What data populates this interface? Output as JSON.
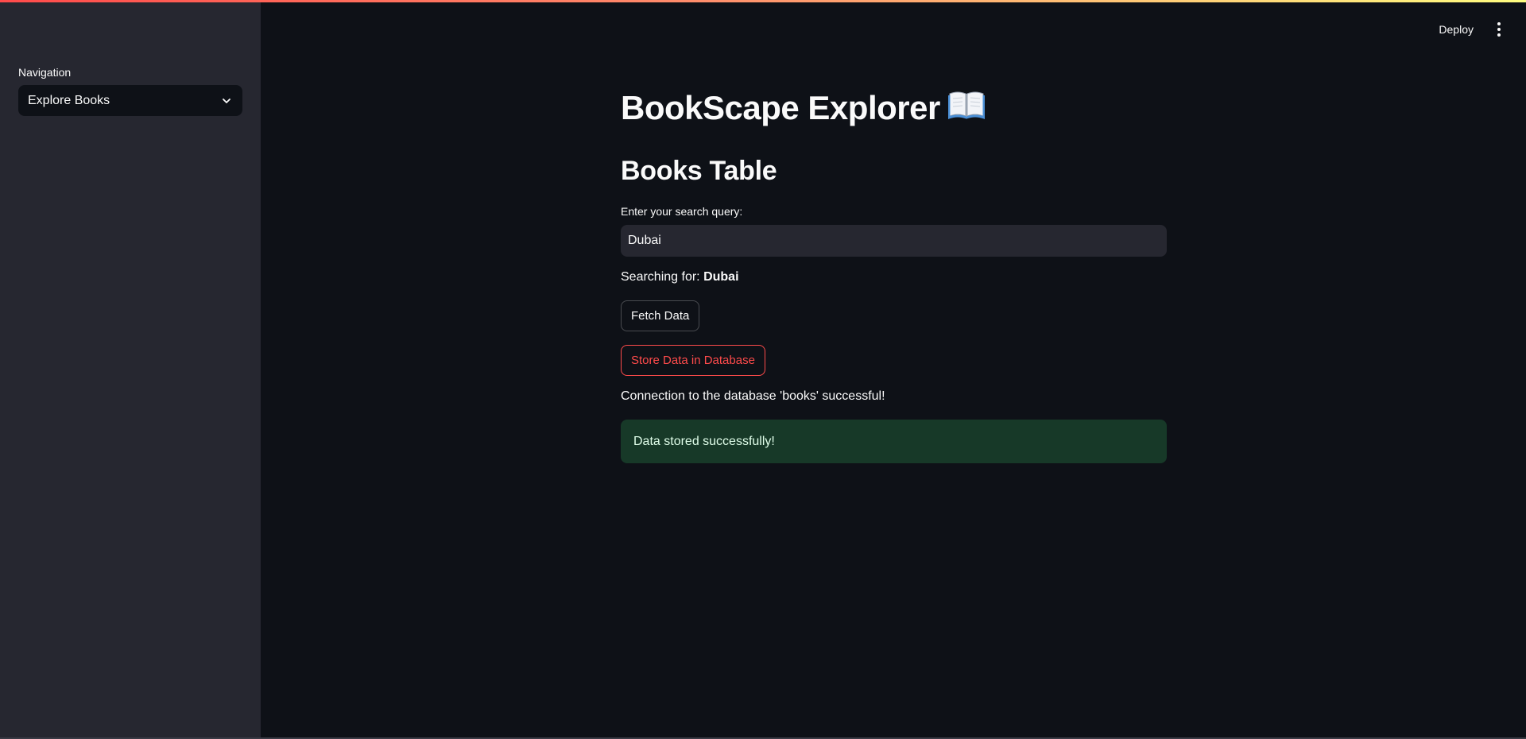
{
  "sidebar": {
    "nav_label": "Navigation",
    "nav_selected": "Explore Books"
  },
  "header": {
    "deploy_label": "Deploy"
  },
  "main": {
    "title": "BookScape Explorer",
    "title_icon": "open-book-icon",
    "section_title": "Books Table",
    "search_label": "Enter your search query:",
    "search_value": "Dubai",
    "searching_prefix": "Searching for:",
    "searching_term": "Dubai",
    "fetch_button": "Fetch Data",
    "store_button": "Store Data in Database",
    "connection_message": "Connection to the database 'books' successful!",
    "success_message": "Data stored successfully!"
  },
  "colors": {
    "background": "#0e1117",
    "sidebar": "#262730",
    "primary": "#ff4b4b",
    "success_bg": "#173928",
    "success_text": "#dffde9"
  }
}
